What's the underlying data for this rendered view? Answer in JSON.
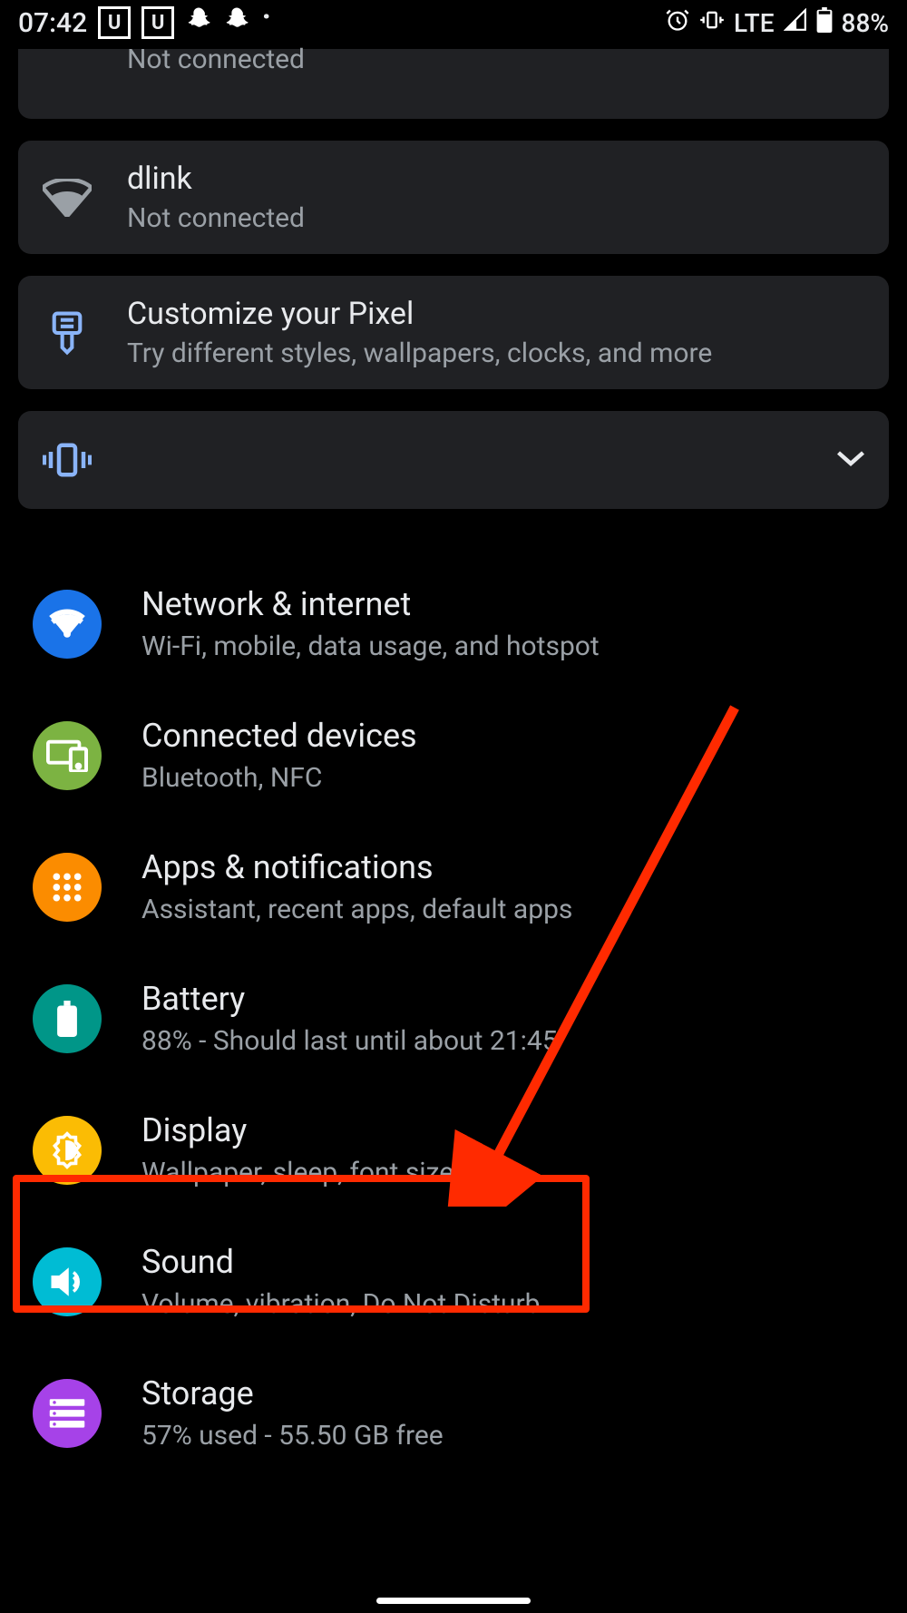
{
  "statusBar": {
    "time": "07:42",
    "network": "LTE",
    "battery": "88%"
  },
  "cards": {
    "wifiTruncated": "Not connected",
    "wifi": {
      "title": "dlink",
      "subtitle": "Not connected"
    },
    "customize": {
      "title": "Customize your Pixel",
      "subtitle": "Try different styles, wallpapers, clocks, and more"
    }
  },
  "settings": {
    "network": {
      "title": "Network & internet",
      "subtitle": "Wi-Fi, mobile, data usage, and hotspot"
    },
    "connected": {
      "title": "Connected devices",
      "subtitle": "Bluetooth, NFC"
    },
    "apps": {
      "title": "Apps & notifications",
      "subtitle": "Assistant, recent apps, default apps"
    },
    "battery": {
      "title": "Battery",
      "subtitle": "88% - Should last until about 21:45"
    },
    "display": {
      "title": "Display",
      "subtitle": "Wallpaper, sleep, font size"
    },
    "sound": {
      "title": "Sound",
      "subtitle": "Volume, vibration, Do Not Disturb"
    },
    "storage": {
      "title": "Storage",
      "subtitle": "57% used - 55.50 GB free"
    }
  }
}
